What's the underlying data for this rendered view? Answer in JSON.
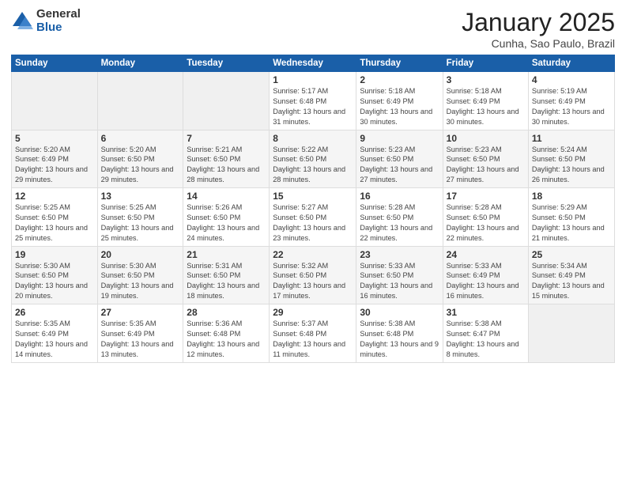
{
  "header": {
    "logo_general": "General",
    "logo_blue": "Blue",
    "title": "January 2025",
    "subtitle": "Cunha, Sao Paulo, Brazil"
  },
  "weekdays": [
    "Sunday",
    "Monday",
    "Tuesday",
    "Wednesday",
    "Thursday",
    "Friday",
    "Saturday"
  ],
  "weeks": [
    [
      {
        "day": "",
        "info": ""
      },
      {
        "day": "",
        "info": ""
      },
      {
        "day": "",
        "info": ""
      },
      {
        "day": "1",
        "info": "Sunrise: 5:17 AM\nSunset: 6:48 PM\nDaylight: 13 hours and 31 minutes."
      },
      {
        "day": "2",
        "info": "Sunrise: 5:18 AM\nSunset: 6:49 PM\nDaylight: 13 hours and 30 minutes."
      },
      {
        "day": "3",
        "info": "Sunrise: 5:18 AM\nSunset: 6:49 PM\nDaylight: 13 hours and 30 minutes."
      },
      {
        "day": "4",
        "info": "Sunrise: 5:19 AM\nSunset: 6:49 PM\nDaylight: 13 hours and 30 minutes."
      }
    ],
    [
      {
        "day": "5",
        "info": "Sunrise: 5:20 AM\nSunset: 6:49 PM\nDaylight: 13 hours and 29 minutes."
      },
      {
        "day": "6",
        "info": "Sunrise: 5:20 AM\nSunset: 6:50 PM\nDaylight: 13 hours and 29 minutes."
      },
      {
        "day": "7",
        "info": "Sunrise: 5:21 AM\nSunset: 6:50 PM\nDaylight: 13 hours and 28 minutes."
      },
      {
        "day": "8",
        "info": "Sunrise: 5:22 AM\nSunset: 6:50 PM\nDaylight: 13 hours and 28 minutes."
      },
      {
        "day": "9",
        "info": "Sunrise: 5:23 AM\nSunset: 6:50 PM\nDaylight: 13 hours and 27 minutes."
      },
      {
        "day": "10",
        "info": "Sunrise: 5:23 AM\nSunset: 6:50 PM\nDaylight: 13 hours and 27 minutes."
      },
      {
        "day": "11",
        "info": "Sunrise: 5:24 AM\nSunset: 6:50 PM\nDaylight: 13 hours and 26 minutes."
      }
    ],
    [
      {
        "day": "12",
        "info": "Sunrise: 5:25 AM\nSunset: 6:50 PM\nDaylight: 13 hours and 25 minutes."
      },
      {
        "day": "13",
        "info": "Sunrise: 5:25 AM\nSunset: 6:50 PM\nDaylight: 13 hours and 25 minutes."
      },
      {
        "day": "14",
        "info": "Sunrise: 5:26 AM\nSunset: 6:50 PM\nDaylight: 13 hours and 24 minutes."
      },
      {
        "day": "15",
        "info": "Sunrise: 5:27 AM\nSunset: 6:50 PM\nDaylight: 13 hours and 23 minutes."
      },
      {
        "day": "16",
        "info": "Sunrise: 5:28 AM\nSunset: 6:50 PM\nDaylight: 13 hours and 22 minutes."
      },
      {
        "day": "17",
        "info": "Sunrise: 5:28 AM\nSunset: 6:50 PM\nDaylight: 13 hours and 22 minutes."
      },
      {
        "day": "18",
        "info": "Sunrise: 5:29 AM\nSunset: 6:50 PM\nDaylight: 13 hours and 21 minutes."
      }
    ],
    [
      {
        "day": "19",
        "info": "Sunrise: 5:30 AM\nSunset: 6:50 PM\nDaylight: 13 hours and 20 minutes."
      },
      {
        "day": "20",
        "info": "Sunrise: 5:30 AM\nSunset: 6:50 PM\nDaylight: 13 hours and 19 minutes."
      },
      {
        "day": "21",
        "info": "Sunrise: 5:31 AM\nSunset: 6:50 PM\nDaylight: 13 hours and 18 minutes."
      },
      {
        "day": "22",
        "info": "Sunrise: 5:32 AM\nSunset: 6:50 PM\nDaylight: 13 hours and 17 minutes."
      },
      {
        "day": "23",
        "info": "Sunrise: 5:33 AM\nSunset: 6:50 PM\nDaylight: 13 hours and 16 minutes."
      },
      {
        "day": "24",
        "info": "Sunrise: 5:33 AM\nSunset: 6:49 PM\nDaylight: 13 hours and 16 minutes."
      },
      {
        "day": "25",
        "info": "Sunrise: 5:34 AM\nSunset: 6:49 PM\nDaylight: 13 hours and 15 minutes."
      }
    ],
    [
      {
        "day": "26",
        "info": "Sunrise: 5:35 AM\nSunset: 6:49 PM\nDaylight: 13 hours and 14 minutes."
      },
      {
        "day": "27",
        "info": "Sunrise: 5:35 AM\nSunset: 6:49 PM\nDaylight: 13 hours and 13 minutes."
      },
      {
        "day": "28",
        "info": "Sunrise: 5:36 AM\nSunset: 6:48 PM\nDaylight: 13 hours and 12 minutes."
      },
      {
        "day": "29",
        "info": "Sunrise: 5:37 AM\nSunset: 6:48 PM\nDaylight: 13 hours and 11 minutes."
      },
      {
        "day": "30",
        "info": "Sunrise: 5:38 AM\nSunset: 6:48 PM\nDaylight: 13 hours and 9 minutes."
      },
      {
        "day": "31",
        "info": "Sunrise: 5:38 AM\nSunset: 6:47 PM\nDaylight: 13 hours and 8 minutes."
      },
      {
        "day": "",
        "info": ""
      }
    ]
  ]
}
